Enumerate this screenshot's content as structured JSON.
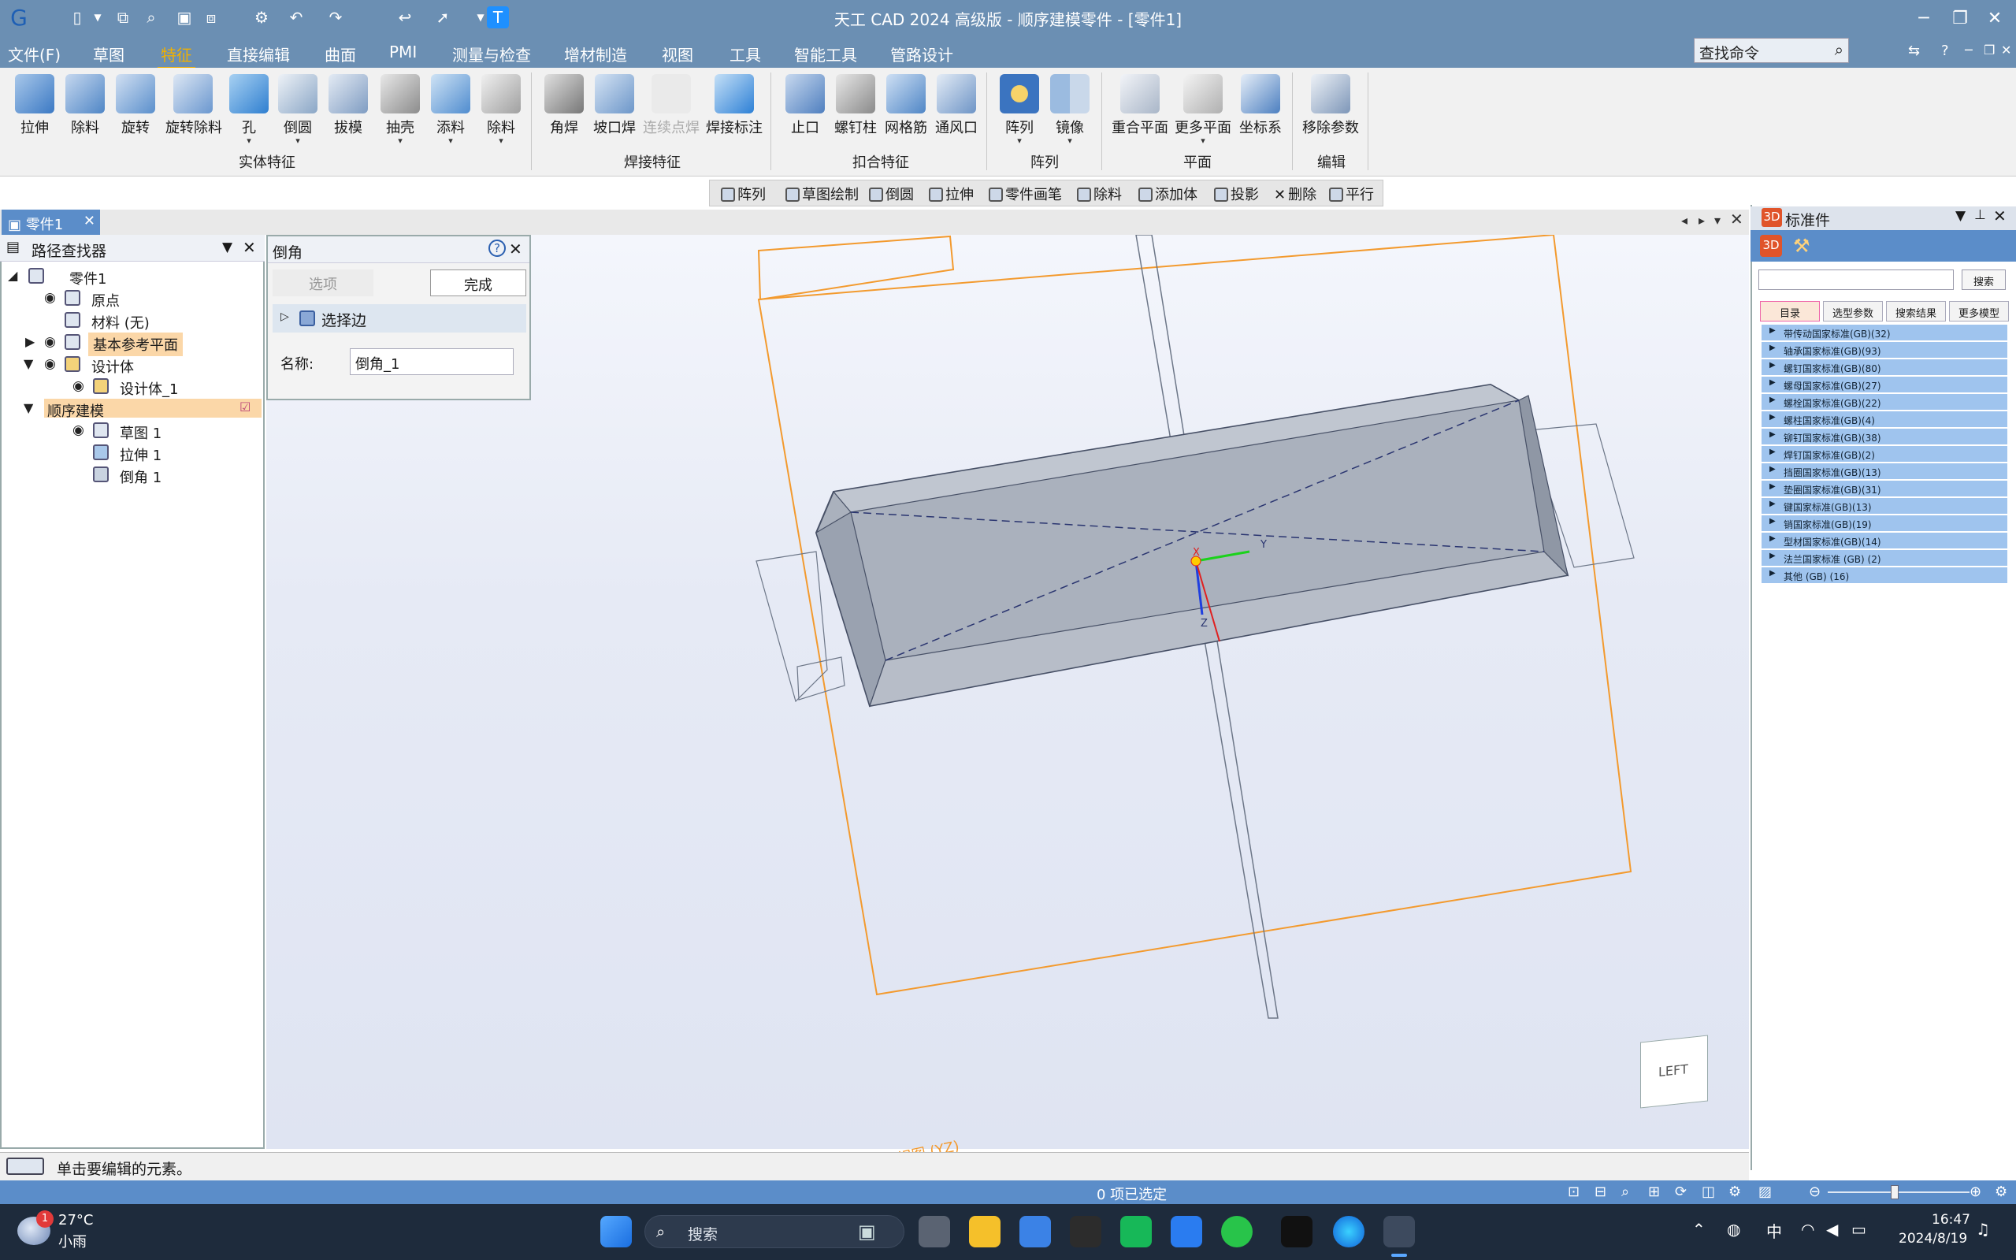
{
  "window": {
    "title": "天工 CAD 2024 高级版 - 顺序建模零件 - [零件1]",
    "controls": {
      "minimize": "─",
      "restore": "❐",
      "close": "✕"
    }
  },
  "menubar": {
    "items": [
      "文件(F)",
      "草图",
      "特征",
      "直接编辑",
      "曲面",
      "PMI",
      "测量与检查",
      "增材制造",
      "视图",
      "工具",
      "智能工具",
      "管路设计"
    ],
    "active": "特征",
    "search_placeholder": "查找命令",
    "right_icons": [
      "⇆",
      "?",
      "─",
      "❐",
      "✕"
    ]
  },
  "ribbon": {
    "buttons": [
      "拉伸",
      "除料",
      "旋转",
      "旋转除料",
      "孔",
      "倒圆",
      "拔模",
      "抽壳",
      "添料",
      "除料",
      "角焊",
      "坡口焊",
      "连续点焊",
      "焊接标注",
      "止口",
      "螺钉柱",
      "网格筋",
      "通风口",
      "阵列",
      "镜像",
      "重合平面",
      "更多平面",
      "坐标系",
      "移除参数"
    ],
    "groups": [
      "实体特征",
      "焊接特征",
      "扣合特征",
      "阵列",
      "平面",
      "编辑"
    ]
  },
  "context_toolbar": [
    "阵列",
    "草图绘制",
    "倒圆",
    "拉伸",
    "零件画笔",
    "除料",
    "添加体",
    "投影",
    "删除",
    "平行"
  ],
  "document_tab": {
    "label": "零件1",
    "close": "✕"
  },
  "pathfinder": {
    "title": "路径查找器",
    "items": [
      "零件1",
      "原点",
      "材料 (无)",
      "基本参考平面",
      "设计体",
      "设计体_1",
      "顺序建模",
      "草图 1",
      "拉伸 1",
      "倒角 1"
    ]
  },
  "chamfer_panel": {
    "title": "倒角",
    "tab_options": "选项",
    "done_button": "完成",
    "select_edge": "选择边",
    "name_label": "名称:",
    "name_value": "倒角_1"
  },
  "viewport": {
    "plane_label": "右视图 (YZ)",
    "axis_labels": {
      "x": "X",
      "y": "Y",
      "z": "Z"
    },
    "view_cube_label": "LEFT"
  },
  "standard_parts": {
    "title": "标准件",
    "search_button": "搜索",
    "tabs": [
      "目录",
      "选型参数",
      "搜索结果",
      "更多模型"
    ],
    "active_tab": "目录",
    "items": [
      "带传动国家标准(GB)(32)",
      "轴承国家标准(GB)(93)",
      "螺钉国家标准(GB)(80)",
      "螺母国家标准(GB)(27)",
      "螺栓国家标准(GB)(22)",
      "螺柱国家标准(GB)(4)",
      "铆钉国家标准(GB)(38)",
      "焊钉国家标准(GB)(2)",
      "挡圈国家标准(GB)(13)",
      "垫圈国家标准(GB)(31)",
      "键国家标准(GB)(13)",
      "销国家标准(GB)(19)",
      "型材国家标准(GB)(14)",
      "法兰国家标准 (GB) (2)",
      "其他 (GB) (16)"
    ]
  },
  "status": {
    "message": "单击要编辑的元素。",
    "selection": "0 项已选定"
  },
  "taskbar": {
    "weather_temp": "27°C",
    "weather_desc": "小雨",
    "weather_badge": "1",
    "search_label": "搜索",
    "ime": "中",
    "time": "16:47",
    "date": "2024/8/19"
  },
  "colors": {
    "title_bar": "#6b8fb3",
    "accent": "#f0b000",
    "tab_blue": "#5b8dc9",
    "highlight_row": "#fbd7a8",
    "sketch_plane": "#f39a2e"
  }
}
